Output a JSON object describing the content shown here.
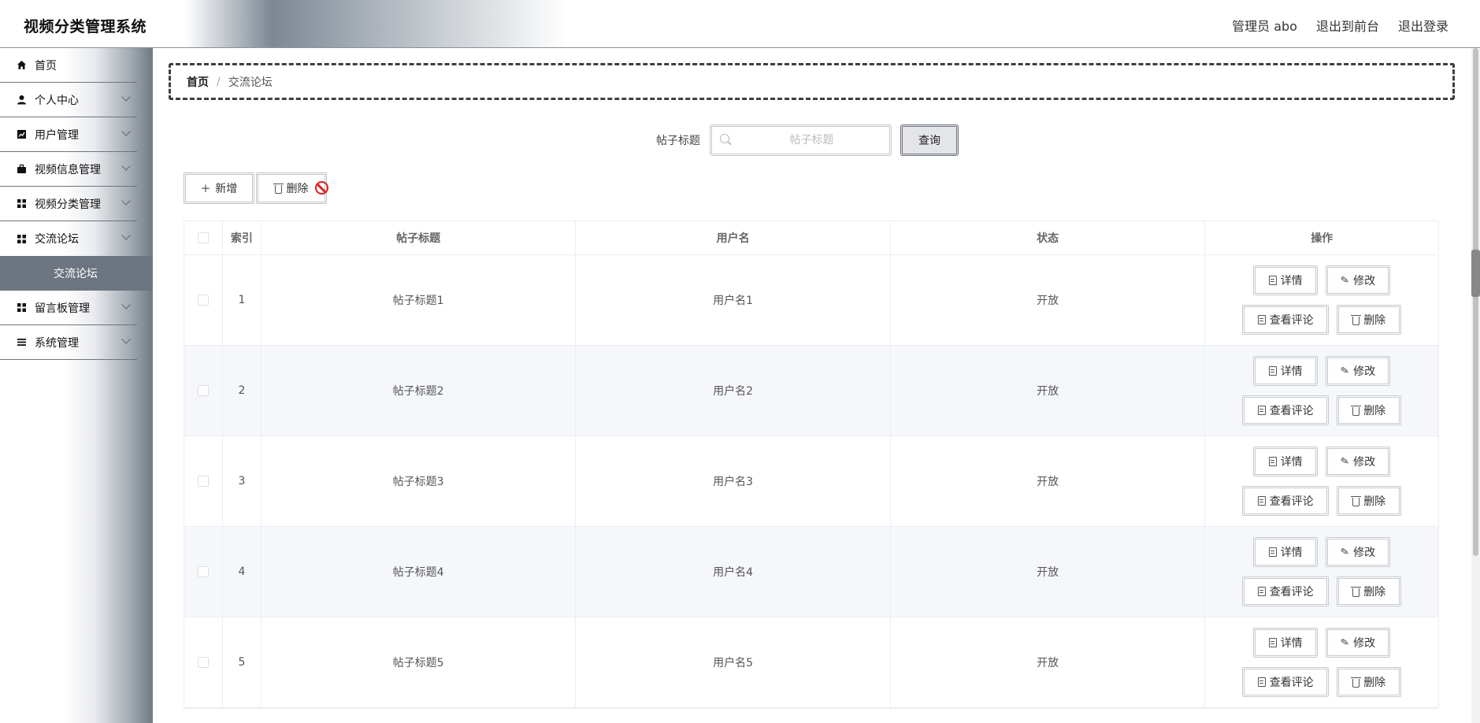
{
  "header": {
    "title": "视频分类管理系统",
    "user": "管理员 abo",
    "to_front": "退出到前台",
    "logout": "退出登录"
  },
  "sidebar": {
    "items": [
      {
        "label": "首页",
        "icon": "home-icon",
        "has_children": false
      },
      {
        "label": "个人中心",
        "icon": "user-icon",
        "has_children": true
      },
      {
        "label": "用户管理",
        "icon": "chart-icon",
        "has_children": true
      },
      {
        "label": "视频信息管理",
        "icon": "briefcase-icon",
        "has_children": true
      },
      {
        "label": "视频分类管理",
        "icon": "grid-icon",
        "has_children": true
      },
      {
        "label": "交流论坛",
        "icon": "grid-icon",
        "has_children": true,
        "expanded": true
      },
      {
        "label": "留言板管理",
        "icon": "grid-icon",
        "has_children": true
      },
      {
        "label": "系统管理",
        "icon": "list-icon",
        "has_children": true
      }
    ],
    "submenu_active": "交流论坛"
  },
  "breadcrumb": {
    "home": "首页",
    "separator": "/",
    "current": "交流论坛"
  },
  "search": {
    "label": "帖子标题",
    "placeholder": "帖子标题",
    "value": "",
    "button": "查询"
  },
  "toolbar": {
    "add_label": "新增",
    "delete_label": "删除"
  },
  "table": {
    "columns": [
      "索引",
      "帖子标题",
      "用户名",
      "状态",
      "操作"
    ],
    "rows": [
      {
        "index": "1",
        "title": "帖子标题1",
        "user": "用户名1",
        "status": "开放"
      },
      {
        "index": "2",
        "title": "帖子标题2",
        "user": "用户名2",
        "status": "开放"
      },
      {
        "index": "3",
        "title": "帖子标题3",
        "user": "用户名3",
        "status": "开放"
      },
      {
        "index": "4",
        "title": "帖子标题4",
        "user": "用户名4",
        "status": "开放"
      },
      {
        "index": "5",
        "title": "帖子标题5",
        "user": "用户名5",
        "status": "开放"
      }
    ],
    "row_actions": {
      "detail": "详情",
      "edit": "修改",
      "comments": "查看评论",
      "delete": "删除"
    }
  },
  "colors": {
    "sidebar_active_bg": "#6d7680",
    "header_gradient_mid": "#7d8894",
    "breadcrumb_border": "#3a3f45",
    "row_alt_bg": "#f5f7fa"
  }
}
